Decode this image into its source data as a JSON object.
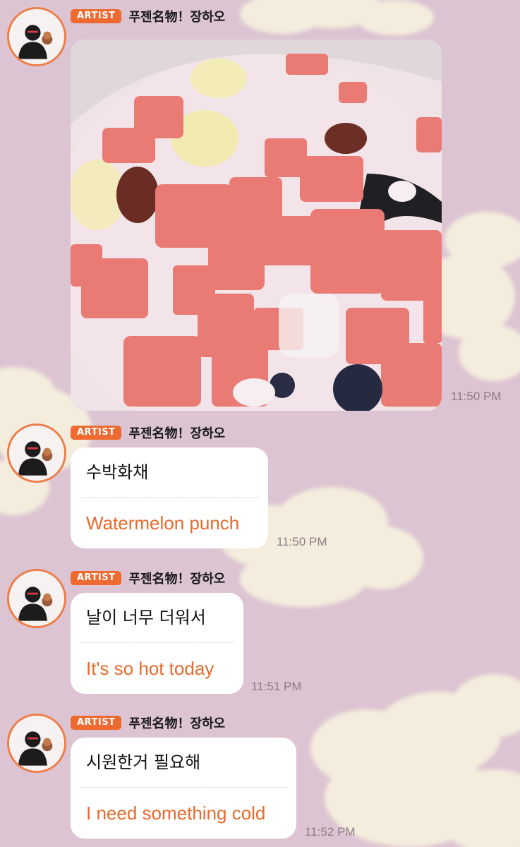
{
  "theme": {
    "accent": "#ef6a30",
    "translation_color": "#e8692c",
    "background": "#dcc4d2",
    "avatar_border": "#ee7d48"
  },
  "messages": [
    {
      "type": "image",
      "badge": "ARTIST",
      "sender": "푸젠名物！장하오",
      "image_icon": "watermelon-punch-photo",
      "time": "11:50 PM"
    },
    {
      "type": "text",
      "badge": "ARTIST",
      "sender": "푸젠名物！장하오",
      "original": "수박화채",
      "translation": "Watermelon punch",
      "time": "11:50 PM"
    },
    {
      "type": "text",
      "badge": "ARTIST",
      "sender": "푸젠名物！장하오",
      "original": "날이 너무 더워서",
      "translation": "It's so hot today",
      "time": "11:51 PM"
    },
    {
      "type": "text",
      "badge": "ARTIST",
      "sender": "푸젠名物！장하오",
      "original": "시원한거 필요해",
      "translation": "I need something cold",
      "time": "11:52 PM"
    }
  ]
}
